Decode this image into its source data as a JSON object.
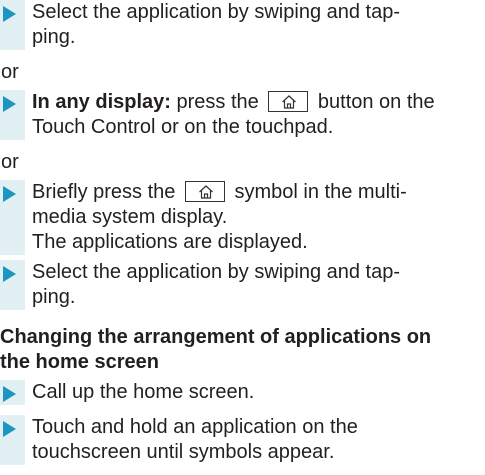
{
  "steps_block1": {
    "s1": [
      "Select the application by swiping and tap-",
      "ping."
    ]
  },
  "or1": "or",
  "steps_block2": {
    "s2_prefix": "In any display:",
    "s2_mid": " press the ",
    "s2_suffix": " button on the",
    "s2_line2": "Touch Control or on the touchpad."
  },
  "or2": "or",
  "steps_block3": {
    "s3_prefix": "Briefly press the ",
    "s3_suffix": " symbol in the multi-",
    "s3_line2": "media system display.",
    "s3_line3": "The applications are displayed.",
    "s4": [
      "Select the application by swiping and tap-",
      "ping."
    ]
  },
  "heading": [
    "Changing the arrangement of applications on",
    "the home screen"
  ],
  "steps_block4": {
    "s5": "Call up the home screen.",
    "s6": [
      "Touch and hold an application on the",
      "touchscreen until symbols appear."
    ]
  },
  "icons": {
    "home": "home-icon",
    "bullet": "triangle-bullet-icon"
  },
  "colors": {
    "bullet": "#1d95c3",
    "bar": "#e2eff3",
    "text": "#231f20"
  }
}
